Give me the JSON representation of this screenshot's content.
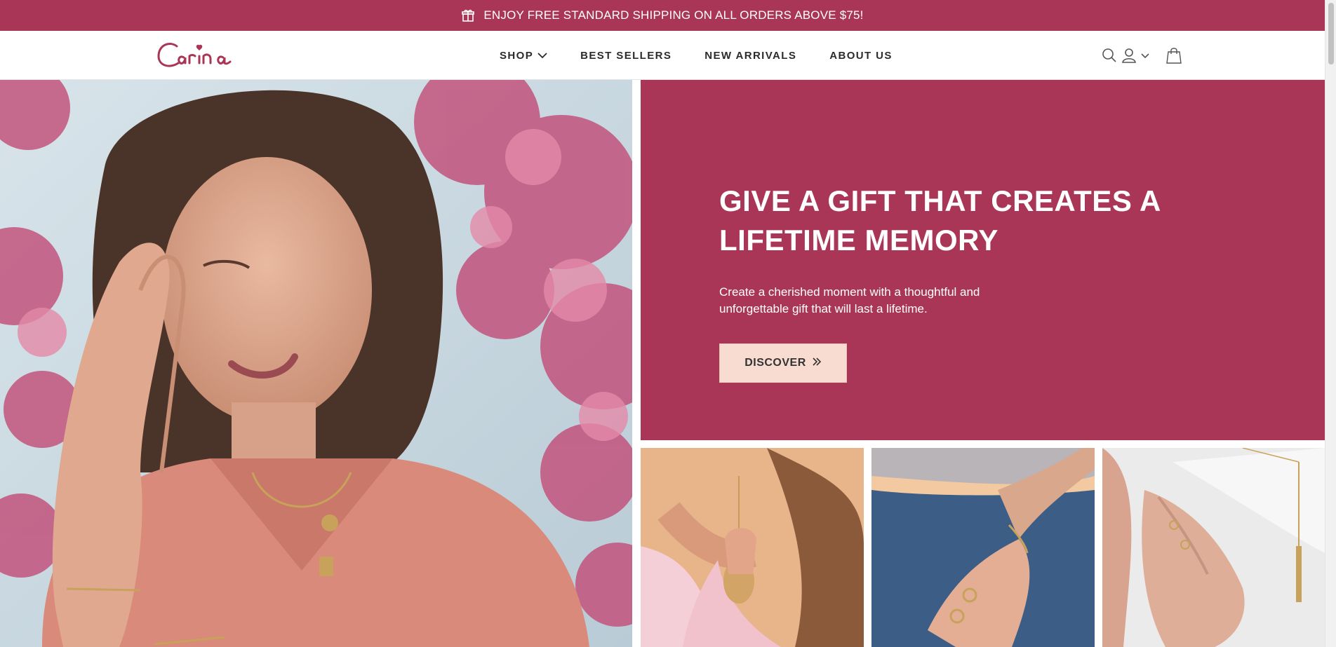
{
  "announcement": {
    "icon": "gift-icon",
    "text": "ENJOY FREE STANDARD SHIPPING ON ALL ORDERS ABOVE $75!"
  },
  "header": {
    "logo_text": "Carina",
    "nav": [
      {
        "label": "SHOP",
        "has_dropdown": true
      },
      {
        "label": "BEST SELLERS"
      },
      {
        "label": "NEW ARRIVALS"
      },
      {
        "label": "ABOUT US"
      }
    ],
    "icons": [
      "search-icon",
      "account-icon",
      "chevron-down-icon",
      "shopping-bag-icon"
    ]
  },
  "hero": {
    "image": "woman-wearing-necklaces-bracelets",
    "heading": "GIVE A GIFT THAT CREATES A LIFETIME MEMORY",
    "subtext": "Create a cherished moment with a thoughtful and unforgettable gift that will last a lifetime.",
    "button_label": "DISCOVER",
    "button_icon": "double-chevron-right-icon"
  },
  "tiles": [
    {
      "image": "locket-necklace"
    },
    {
      "image": "bracelet-and-rings"
    },
    {
      "image": "rings-and-bar-necklace"
    }
  ],
  "colors": {
    "brand": "#a93656",
    "button_bg": "#f8dcd2",
    "text_dark": "#2b2b2b"
  }
}
